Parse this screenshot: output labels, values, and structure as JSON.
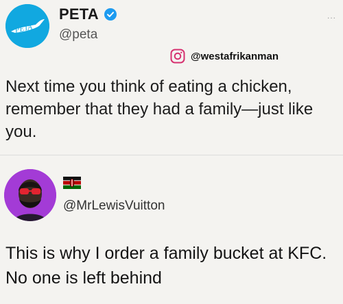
{
  "peta_tweet": {
    "avatar_logo": "PETA",
    "name": "PETA",
    "handle": "@peta",
    "verified_icon": "verified-badge-icon",
    "more_icon": "more-dots-icon",
    "more_dots": "...",
    "watermark": {
      "icon": "instagram-icon",
      "text": "@westafrikanman"
    },
    "text": "Next time you think of eating a chicken, remember that they had a family—just like you."
  },
  "reply": {
    "flag_icon": "kenya-flag-icon",
    "handle": "@MrLewisVuitton",
    "text": "This is why I order a family bucket at KFC. No one is left behind"
  },
  "colors": {
    "peta_blue": "#11a8e0",
    "verified_blue": "#1d9bf0",
    "avatar_purple": "#a33bd6",
    "background": "#f4f3f0"
  }
}
